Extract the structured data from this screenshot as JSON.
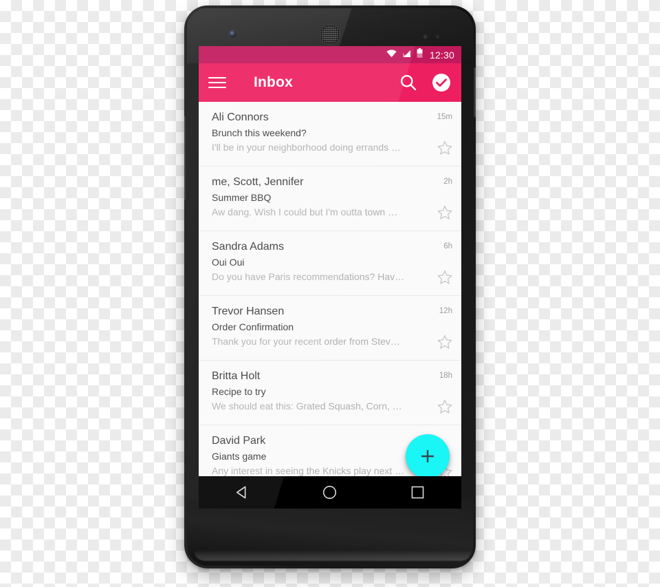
{
  "statusbar": {
    "time": "12:30",
    "icons": [
      "wifi-icon",
      "signal-icon",
      "battery-icon"
    ]
  },
  "toolbar": {
    "title": "Inbox",
    "menu_icon": "hamburger-menu-icon",
    "search_icon": "search-icon",
    "check_icon": "check-circle-icon",
    "background_color": "#ED1F60"
  },
  "fab": {
    "label": "+",
    "icon": "plus-icon",
    "color": "#1AF5F5"
  },
  "navbar": {
    "back": "back-triangle-icon",
    "home": "home-circle-icon",
    "recents": "recents-square-icon"
  },
  "list": {
    "items": [
      {
        "sender": "Ali Connors",
        "subject": "Brunch this weekend?",
        "snippet": "I'll be in your neighborhood doing errands …",
        "time": "15m",
        "starred": false
      },
      {
        "sender": "me, Scott, Jennifer",
        "subject": "Summer BBQ",
        "snippet": "Aw dang. Wish I could but I'm outta town …",
        "time": "2h",
        "starred": false
      },
      {
        "sender": "Sandra Adams",
        "subject": "Oui Oui",
        "snippet": "Do you have Paris recommendations? Hav…",
        "time": "6h",
        "starred": false
      },
      {
        "sender": "Trevor Hansen",
        "subject": "Order Confirmation",
        "snippet": "Thank you for your recent order from Stev…",
        "time": "12h",
        "starred": false
      },
      {
        "sender": "Britta Holt",
        "subject": "Recipe to try",
        "snippet": "We should eat this: Grated Squash, Corn, …",
        "time": "18h",
        "starred": false
      },
      {
        "sender": "David Park",
        "subject": "Giants game",
        "snippet": "Any interest in seeing the Knicks play next …",
        "time": "",
        "starred": false
      }
    ]
  }
}
